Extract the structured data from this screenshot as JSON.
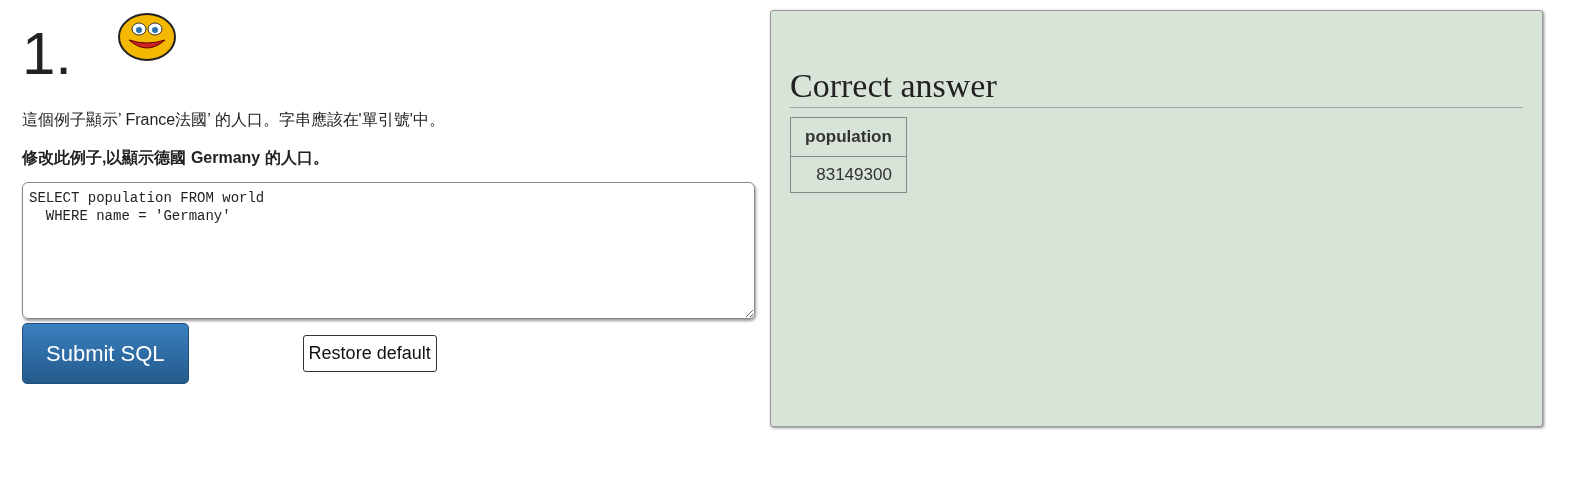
{
  "question": {
    "number": "1.",
    "description": "這個例子顯示’ France法國’ 的人口。字串應該在'單引號'中。",
    "task": "修改此例子,以顯示德國 Germany 的人口。"
  },
  "editor": {
    "value": "SELECT population FROM world\n  WHERE name = 'Germany'"
  },
  "buttons": [
    {
      "kind": "primary",
      "label": "Submit SQL"
    },
    {
      "kind": "plain",
      "label": "Restore default"
    }
  ],
  "answer": {
    "title": "Correct answer",
    "columns": [
      "population"
    ],
    "rows": [
      [
        "83149300"
      ]
    ]
  }
}
